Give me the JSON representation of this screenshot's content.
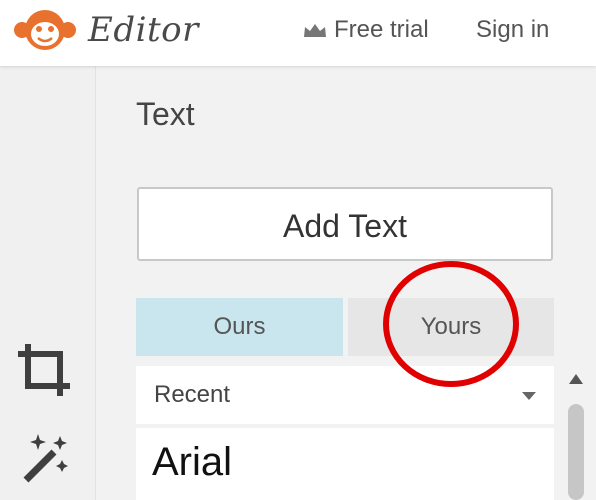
{
  "header": {
    "brand": "Editor",
    "free_trial": "Free trial",
    "sign_in": "Sign in",
    "logo_icon": "monkey-logo-icon",
    "crown_icon": "crown-icon"
  },
  "panel": {
    "title": "Text",
    "add_text_button": "Add Text",
    "tabs": [
      {
        "label": "Ours",
        "active": true
      },
      {
        "label": "Yours",
        "active": false
      }
    ],
    "filter_dropdown": {
      "selected": "Recent"
    },
    "fonts": [
      "Arial"
    ]
  },
  "tools": [
    {
      "icon": "crop-icon"
    },
    {
      "icon": "magic-wand-icon"
    }
  ],
  "colors": {
    "accent_logo": "#e8712e",
    "tab_active": "#c9e6ee",
    "tab_inactive": "#e6e6e6",
    "highlight_circle": "#e00000"
  }
}
